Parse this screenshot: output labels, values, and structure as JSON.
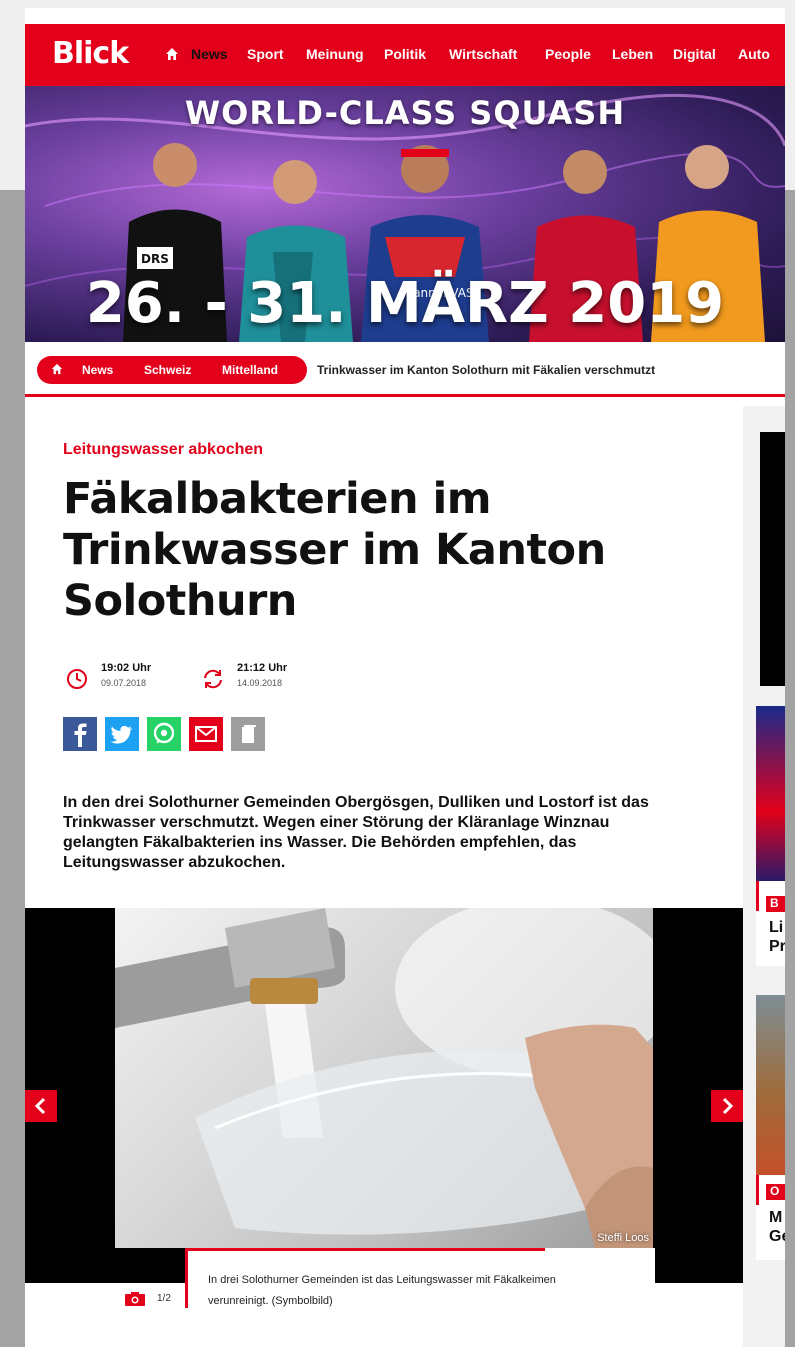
{
  "site": {
    "logo": "Blick",
    "nav": [
      "News",
      "Sport",
      "Meinung",
      "Politik",
      "Wirtschaft",
      "People",
      "Leben",
      "Digital",
      "Auto"
    ],
    "active_nav": "News",
    "accent": "#e2001a"
  },
  "ad": {
    "title": "WORLD-CLASS SQUASH",
    "dates": "26. - 31. MÄRZ 2019",
    "jersey_labels": [
      "DRS",
      "channel VAS"
    ]
  },
  "breadcrumb": {
    "items": [
      "News",
      "Schweiz",
      "Mittelland"
    ],
    "current": "Trinkwasser im Kanton Solothurn mit Fäkalien verschmutzt"
  },
  "article": {
    "kicker": "Leitungswasser abkochen",
    "headline_lines": [
      "Fäkalbakterien im",
      "Trinkwasser im Kanton",
      "Solothurn"
    ],
    "published_time": "19:02 Uhr",
    "published_date": "09.07.2018",
    "updated_time": "21:12 Uhr",
    "updated_date": "14.09.2018",
    "lead": "In den drei Solothurner Gemeinden Obergösgen, Dulliken und Lostorf ist das Trinkwasser verschmutzt. Wegen einer Störung der Kläranlage Winznau gelangten Fäkalbakterien ins Wasser. Die Behörden empfehlen, das Leitungswasser abzukochen."
  },
  "share": {
    "icons": [
      "facebook-icon",
      "twitter-icon",
      "whatsapp-icon",
      "email-icon",
      "copy-icon"
    ],
    "colors": [
      "#3b5998",
      "#1da1f2",
      "#25d366",
      "#e2001a",
      "#9e9e9e"
    ]
  },
  "gallery": {
    "credit": "Steffi Loos",
    "caption_lines": [
      "In drei Solothurner Gemeinden ist das Leitungswasser mit Fäkalkeimen",
      "verunreinigt. (Symbolbild)"
    ],
    "counter": "1/2"
  },
  "sidebar": {
    "card1_tag": "B",
    "card1_lines": [
      "Li",
      "Pr"
    ],
    "card2_tag": "O",
    "card2_lines": [
      "M",
      "Ge"
    ]
  }
}
